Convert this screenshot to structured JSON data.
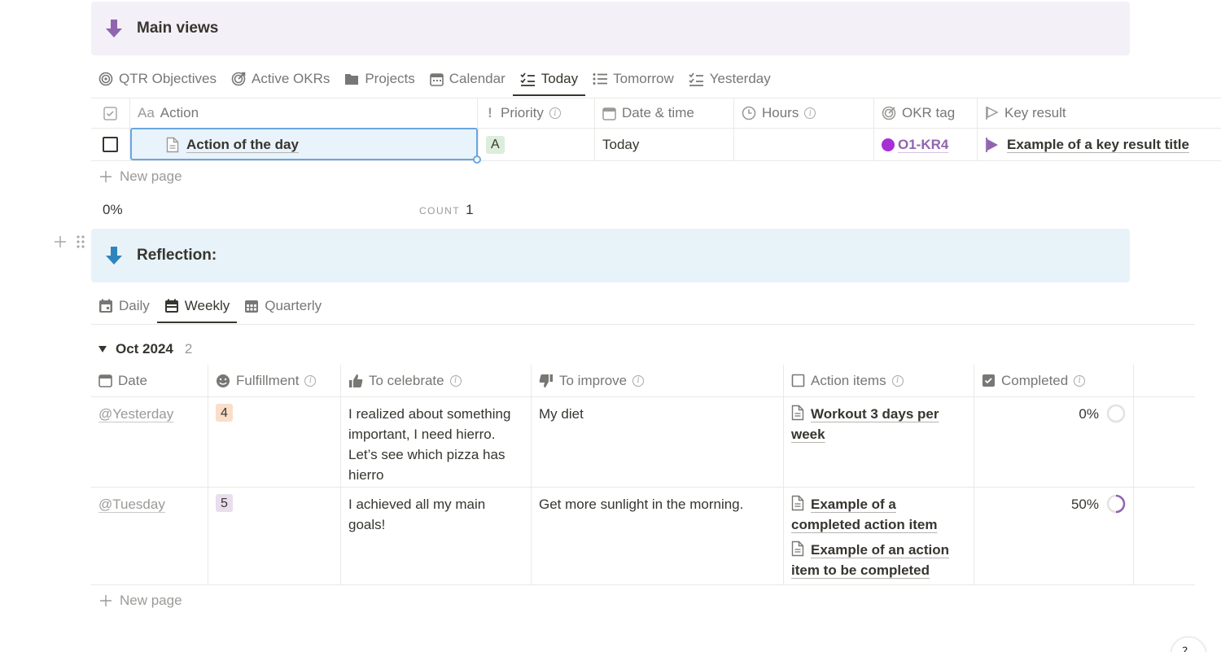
{
  "main_views": {
    "title": "Main views",
    "tabs": [
      {
        "label": "QTR Objectives",
        "icon": "target-icon"
      },
      {
        "label": "Active OKRs",
        "icon": "target-arrow-icon"
      },
      {
        "label": "Projects",
        "icon": "folder-icon"
      },
      {
        "label": "Calendar",
        "icon": "calendar-icon"
      },
      {
        "label": "Today",
        "icon": "checklist-icon",
        "active": true
      },
      {
        "label": "Tomorrow",
        "icon": "list-icon"
      },
      {
        "label": "Yesterday",
        "icon": "checklist-icon"
      }
    ],
    "columns": {
      "action": "Action",
      "action_prefix": "Aa",
      "priority": "Priority",
      "date_time": "Date & time",
      "hours": "Hours",
      "okr_tag": "OKR tag",
      "key_result": "Key result"
    },
    "rows": [
      {
        "action": "Action of the day",
        "priority": "A",
        "date_time": "Today",
        "hours": "",
        "okr_tag": "O1-KR4",
        "key_result": "Example of a key result title"
      }
    ],
    "new_page": "New page",
    "footer": {
      "percent": "0%",
      "count_label": "COUNT",
      "count_value": "1"
    }
  },
  "reflection": {
    "title": "Reflection:",
    "tabs": [
      {
        "label": "Daily",
        "icon": "calendar-icon"
      },
      {
        "label": "Weekly",
        "icon": "calendar-icon",
        "active": true
      },
      {
        "label": "Quarterly",
        "icon": "calendar-icon"
      }
    ],
    "group": {
      "label": "Oct 2024",
      "count": "2"
    },
    "columns": {
      "date": "Date",
      "fulfillment": "Fulfillment",
      "to_celebrate": "To celebrate",
      "to_improve": "To improve",
      "action_items": "Action items",
      "completed": "Completed"
    },
    "rows": [
      {
        "date": "@Yesterday",
        "fulfillment": "4",
        "to_celebrate": "I realized about something important, I need hierro. Let’s see which pizza has hierro",
        "to_improve": "My diet",
        "action_items": [
          "Workout 3 days per week"
        ],
        "completed": "0%",
        "completed_fraction": 0
      },
      {
        "date": "@Tuesday",
        "fulfillment": "5",
        "to_celebrate": "I achieved all my main goals!",
        "to_improve": "Get more sunlight in the morning.",
        "action_items": [
          "Example of a completed action item",
          "Example of an action item to be completed"
        ],
        "completed": "50%",
        "completed_fraction": 0.5
      }
    ],
    "new_page": "New page"
  },
  "colors": {
    "accent_purple": "#9065b0",
    "accent_blue": "#2f84bd",
    "selection_blue": "#6aa6e0"
  }
}
